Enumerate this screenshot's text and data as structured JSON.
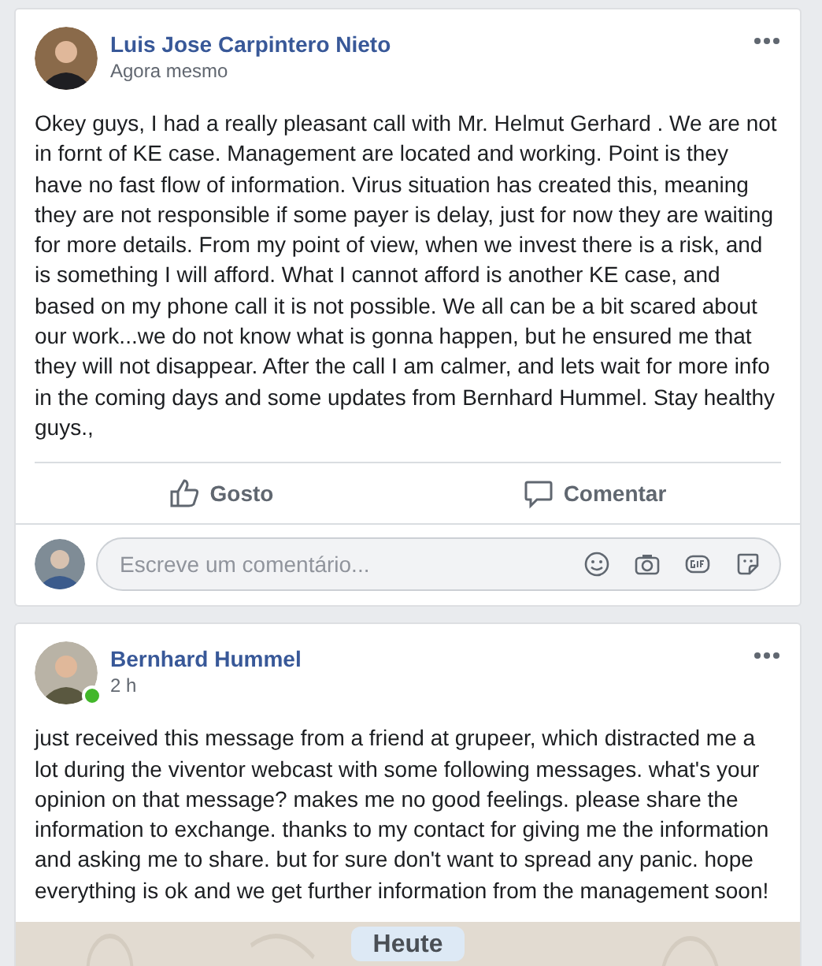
{
  "posts": [
    {
      "author": "Luis Jose Carpintero Nieto",
      "time": "Agora mesmo",
      "online": false,
      "text": "Okey guys, I had a really pleasant call with Mr. Helmut Gerhard . We are not in fornt of KE case. Management are located and working. Point is they have no fast flow of information. Virus situation has created this, meaning they are not responsible if some payer is delay, just for now they are waiting for more details. From my point of view, when we invest there is a risk, and is something I will afford. What I cannot afford is another KE case, and based on my phone call it is not possible. We all can be a bit scared about our work...we do not know what is gonna happen, but he ensured me that they will not disappear. After the call I am calmer, and lets wait for more info in the coming days and some updates from Bernhard Hummel. Stay healthy guys.,",
      "actions": [
        "Gosto",
        "Comentar"
      ],
      "comment": {
        "placeholder": "Escreve um comentário..."
      }
    },
    {
      "author": "Bernhard Hummel",
      "time": "2 h",
      "online": true,
      "text": "just received this message from a friend at grupeer, which distracted me a lot during the viventor webcast with some following messages. what's your opinion on that message? makes me no good feelings. please share the information to exchange. thanks to my contact for giving me the information and asking me to share. but for sure don't want to spread any panic. hope everything is ok and we get further information from the management soon!",
      "attachment": {
        "kind": "chat-screenshot",
        "date_badge": "Heute"
      }
    }
  ]
}
